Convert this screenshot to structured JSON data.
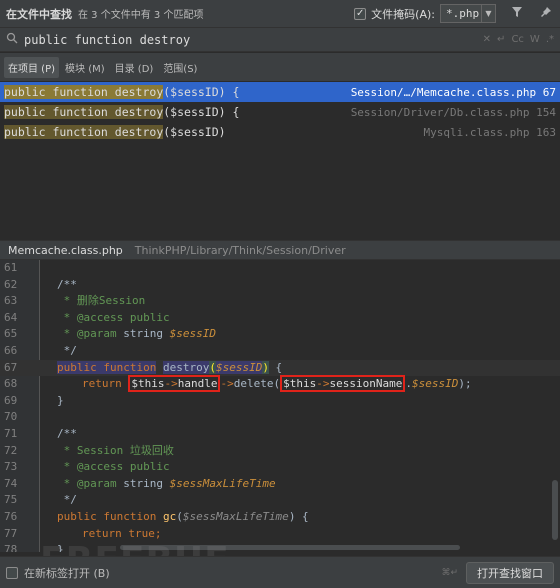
{
  "header": {
    "title": "在文件中查找",
    "stats": "在 3 个文件中有 3 个匹配项",
    "file_mask_label": "文件掩码(A):",
    "file_mask_value": "*.php",
    "checkbox_mark": "✓",
    "filter_icon": "funnel-icon",
    "pin_icon": "pin-icon"
  },
  "search": {
    "query": "public function destroy",
    "option_case": "Cc",
    "option_word": "W",
    "option_regex": ".*"
  },
  "scopes": [
    {
      "label": "在项目 (P)",
      "active": true
    },
    {
      "label": "模块 (M)",
      "active": false
    },
    {
      "label": "目录 (D)",
      "active": false
    },
    {
      "label": "范围(S)",
      "active": false
    }
  ],
  "results": [
    {
      "match": "public function destroy",
      "rest": "($sessID) {",
      "file": "Session/…/Memcache.class.php 67"
    },
    {
      "match": "public function destroy",
      "rest": "($sessID) {",
      "file": "Session/Driver/Db.class.php 154"
    },
    {
      "match": "public function destroy",
      "rest": "($sessID)",
      "file": "Mysqli.class.php 163"
    }
  ],
  "preview": {
    "file": "Memcache.class.php",
    "path": "ThinkPHP/Library/Think/Session/Driver"
  },
  "code": {
    "line_numbers": [
      "61",
      "62",
      "63",
      "64",
      "65",
      "66",
      "67",
      "68",
      "69",
      "70",
      "71",
      "72",
      "73",
      "74",
      "75",
      "76",
      "77",
      "78"
    ],
    "l62": "/**",
    "l63a": " * ",
    "l63b": "删除Session",
    "l64a": " * ",
    "l64b": "@access",
    "l64c": " public",
    "l65a": " * ",
    "l65b": "@param",
    "l65c": " string ",
    "l65d": "$sessID",
    "l66": " */",
    "l67_kw": "public function",
    "l67_fn": "destroy",
    "l67_open": "(",
    "l67_var": "$sessID",
    "l67_close": ")",
    "l67_brace": " {",
    "l68_return": "return ",
    "l68_this1": "$this",
    "l68_arrow1": "->",
    "l68_prop1": "handle",
    "l68_arrow2": "->",
    "l68_fn": "delete",
    "l68_paren": "(",
    "l68_this2": "$this",
    "l68_arrow3": "->",
    "l68_prop2": "sessionName",
    "l68_dot": ".",
    "l68_var": "$sessID",
    "l68_end": ");",
    "l69": "}",
    "l71": "/**",
    "l72a": " * ",
    "l72b": "Session 垃圾回收",
    "l73a": " * ",
    "l73b": "@access",
    "l73c": " public",
    "l74a": " * ",
    "l74b": "@param",
    "l74c": " string ",
    "l74d": "$sessMaxLifeTime",
    "l75": " */",
    "l76_kw": "public function",
    "l76_fn": "gc",
    "l76_open": "(",
    "l76_var": "$sessMaxLifeTime",
    "l76_close": ") {",
    "l77_kw": "return true",
    "l77_end": ";",
    "l78": "}"
  },
  "footer": {
    "open_in_new_tab": "在新标签打开 (B)",
    "shortcut": "⌘↵",
    "open_window_button": "打开查找窗口",
    "watermark": "FREEBUF"
  },
  "colors": {
    "selection": "#2f65ca",
    "match_highlight": "#63582e",
    "annotation_box": "#e0231a"
  }
}
